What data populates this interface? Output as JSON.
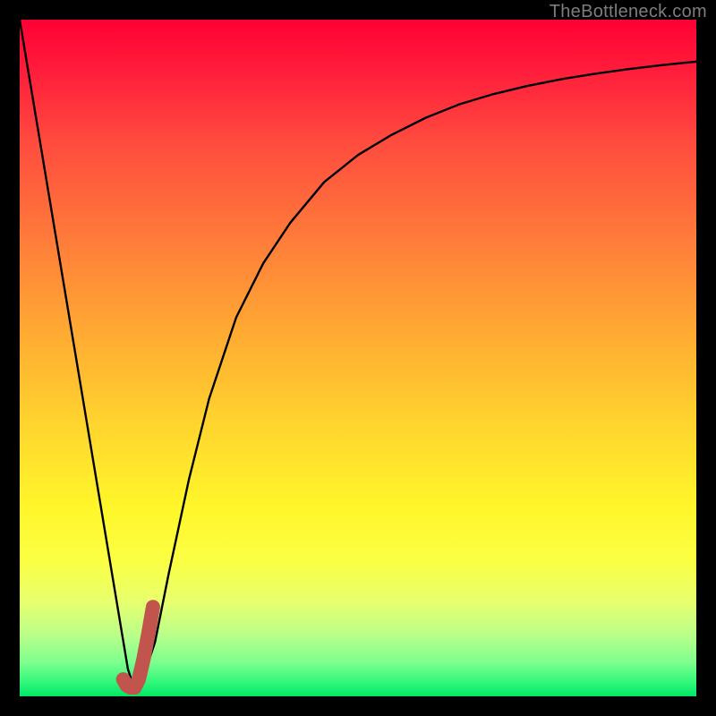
{
  "watermark": "TheBottleneck.com",
  "chart_data": {
    "type": "line",
    "title": "",
    "xlabel": "",
    "ylabel": "",
    "xlim": [
      0,
      100
    ],
    "ylim": [
      0,
      100
    ],
    "series": [
      {
        "name": "bottleneck-curve",
        "color": "#000000",
        "x": [
          0,
          3,
          6,
          9,
          12,
          15,
          16,
          17,
          18,
          20,
          22,
          25,
          28,
          32,
          36,
          40,
          45,
          50,
          55,
          60,
          65,
          70,
          75,
          80,
          85,
          90,
          95,
          100
        ],
        "values": [
          100,
          82,
          64,
          46,
          28,
          10,
          4,
          1,
          2,
          8,
          18,
          32,
          44,
          56,
          64,
          70,
          76,
          80,
          83,
          85.5,
          87.5,
          89,
          90.2,
          91.2,
          92,
          92.7,
          93.3,
          93.8
        ]
      },
      {
        "name": "highlight-segment",
        "color": "#c1554e",
        "x": [
          15.3,
          15.8,
          16.4,
          17.0,
          17.6,
          18.3,
          19.0,
          19.7
        ],
        "values": [
          2.5,
          1.6,
          1.3,
          1.3,
          2.5,
          5.5,
          9.2,
          13.2
        ]
      }
    ],
    "background_gradient": {
      "top": "#ff0034",
      "upper_mid": "#ff7a3a",
      "mid": "#ffd52e",
      "lower_mid": "#fbff43",
      "bottom": "#00e865"
    }
  }
}
